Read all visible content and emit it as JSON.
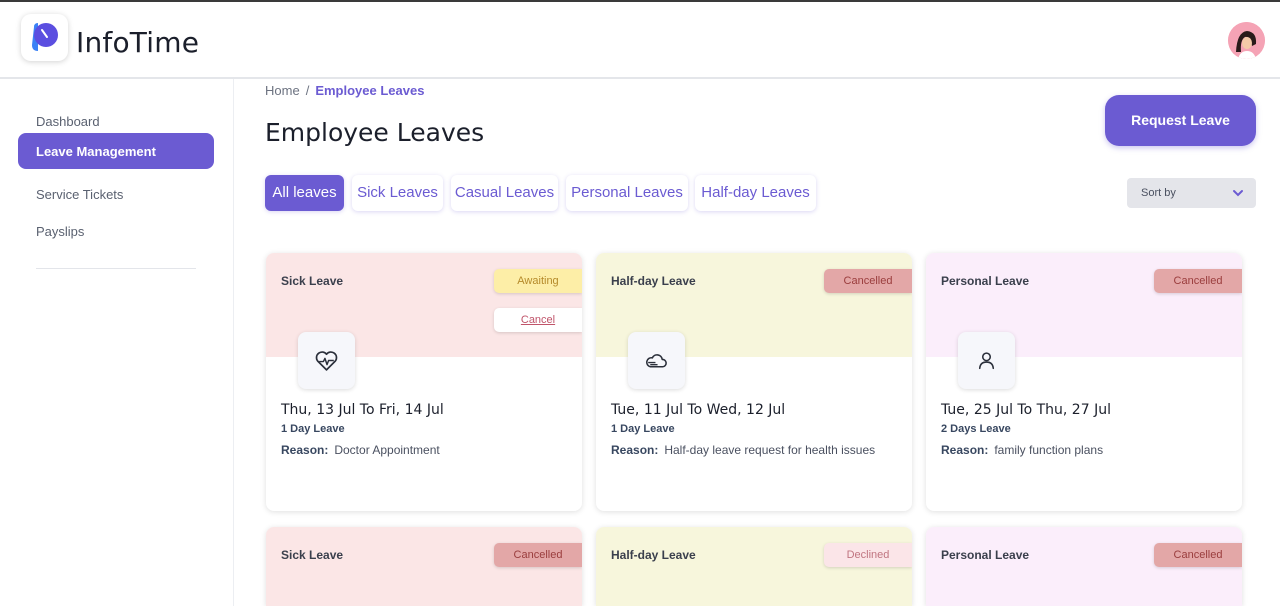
{
  "app": {
    "name": "InfoTime"
  },
  "sidebar": {
    "items": [
      {
        "label": "Dashboard",
        "active": false
      },
      {
        "label": "Leave Management",
        "active": true
      },
      {
        "label": "Service Tickets",
        "active": false
      },
      {
        "label": "Payslips",
        "active": false
      }
    ]
  },
  "breadcrumb": {
    "home": "Home",
    "separator": "/",
    "current": "Employee Leaves"
  },
  "page": {
    "title": "Employee Leaves",
    "request_button": "Request Leave"
  },
  "tabs": [
    {
      "label": "All leaves",
      "active": true
    },
    {
      "label": "Sick Leaves",
      "active": false
    },
    {
      "label": "Casual Leaves",
      "active": false
    },
    {
      "label": "Personal Leaves",
      "active": false
    },
    {
      "label": "Half-day Leaves",
      "active": false
    }
  ],
  "sort": {
    "label": "Sort by"
  },
  "cards": [
    {
      "type": "Sick Leave",
      "status": "Awaiting",
      "action": "Cancel",
      "icon": "heartbeat-icon",
      "dates": "Thu, 13 Jul To Fri, 14 Jul",
      "days": "1 Day Leave",
      "reason_label": "Reason:",
      "reason": "Doctor Appointment"
    },
    {
      "type": "Half-day Leave",
      "status": "Cancelled",
      "icon": "cloud-icon",
      "dates": "Tue, 11 Jul To Wed, 12 Jul",
      "days": "1 Day Leave",
      "reason_label": "Reason:",
      "reason": "Half-day leave request for health issues"
    },
    {
      "type": "Personal Leave",
      "status": "Cancelled",
      "icon": "person-icon",
      "dates": "Tue, 25 Jul To Thu, 27 Jul",
      "days": "2 Days Leave",
      "reason_label": "Reason:",
      "reason": "family function plans"
    },
    {
      "type": "Sick Leave",
      "status": "Cancelled"
    },
    {
      "type": "Half-day Leave",
      "status": "Declined"
    },
    {
      "type": "Personal Leave",
      "status": "Cancelled"
    }
  ],
  "colors": {
    "accent": "#6b5bd2",
    "sick_header": "#fbe6e6",
    "halfday_header": "#f7f6dc",
    "personal_header": "#fbeefb",
    "awaiting_badge": "#fdeea7",
    "cancelled_badge": "#e3a7a7",
    "declined_badge": "#fbe5e8"
  }
}
